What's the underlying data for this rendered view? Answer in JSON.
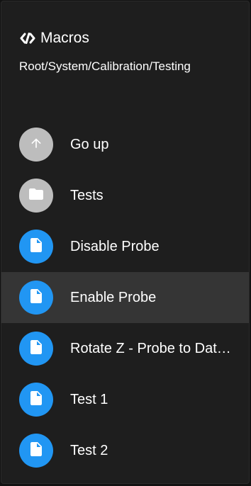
{
  "header": {
    "title": "Macros",
    "path": "Root/System/Calibration/Testing",
    "title_icon": "code-icon"
  },
  "items": [
    {
      "label": "Go up",
      "icon": "arrow-up-icon",
      "avatar_color": "#bdbdbd"
    },
    {
      "label": "Tests",
      "icon": "folder-icon",
      "avatar_color": "#bdbdbd"
    },
    {
      "label": "Disable Probe",
      "icon": "file-icon",
      "avatar_color": "#2196f3"
    },
    {
      "label": "Enable Probe",
      "icon": "file-icon",
      "avatar_color": "#2196f3",
      "selected": true
    },
    {
      "label": "Rotate Z - Probe to Datum",
      "icon": "file-icon",
      "avatar_color": "#2196f3"
    },
    {
      "label": "Test 1",
      "icon": "file-icon",
      "avatar_color": "#2196f3"
    },
    {
      "label": "Test 2",
      "icon": "file-icon",
      "avatar_color": "#2196f3"
    }
  ],
  "colors": {
    "panel_background": "#1e1e1e",
    "selected_row": "#353535",
    "directory_avatar": "#bdbdbd",
    "file_avatar": "#2196f3"
  }
}
